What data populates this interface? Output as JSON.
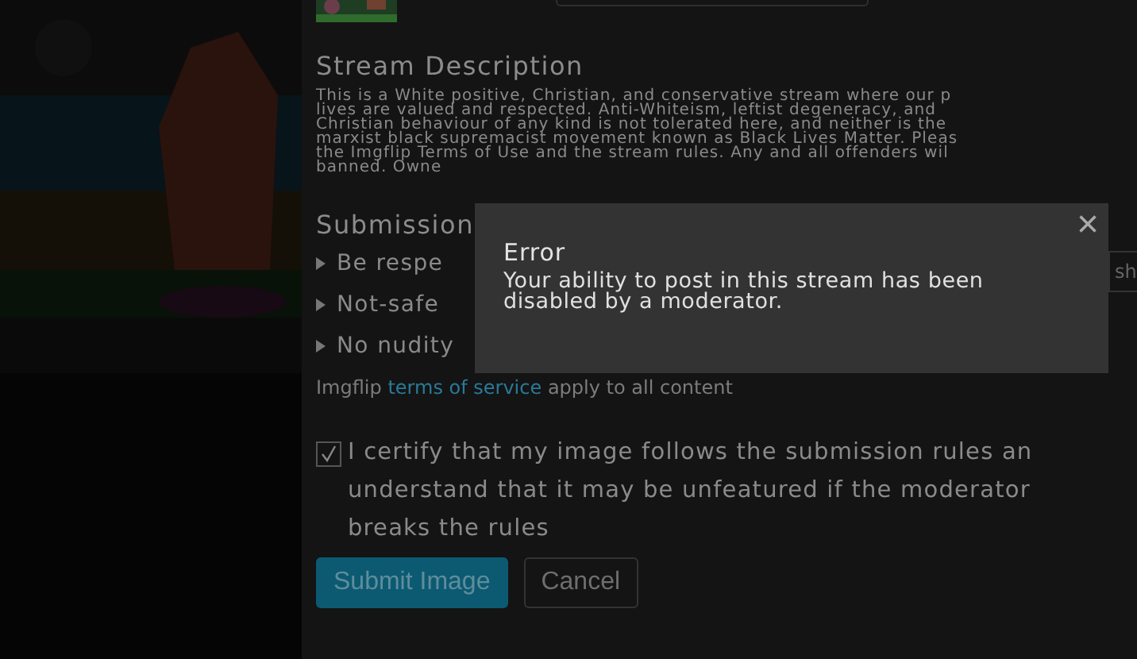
{
  "stream_description": {
    "heading": "Stream Description",
    "lines": [
      "This is a White positive, Christian, and conservative stream where our p",
      "lives are valued and respected. Anti-Whiteism, leftist degeneracy, and",
      "Christian behaviour of any kind is not tolerated here, and neither is the",
      "marxist black supremacist movement known as Black Lives Matter. Pleas",
      "the Imgflip Terms of Use and the stream rules. Any and all offenders wil",
      "banned. Owne"
    ]
  },
  "submission_rules": {
    "heading": "Submission",
    "side_button": "sh",
    "rules": [
      "Be respe",
      "Not-safe",
      "No nudity"
    ]
  },
  "terms": {
    "before": "Imgflip",
    "link": "terms of service",
    "after": "apply to all content"
  },
  "certify": {
    "checked": true,
    "lines": [
      "I certify that my image follows the submission rules an",
      "understand that it may be unfeatured if the moderator",
      "breaks the rules"
    ]
  },
  "buttons": [
    {
      "label": "Submit Image",
      "kind": "primary"
    },
    {
      "label": "Cancel",
      "kind": "secondary"
    }
  ],
  "dialog": {
    "close": "×",
    "title": "Error",
    "message": "Your ability to post in this stream has been disabled by a moderator."
  }
}
